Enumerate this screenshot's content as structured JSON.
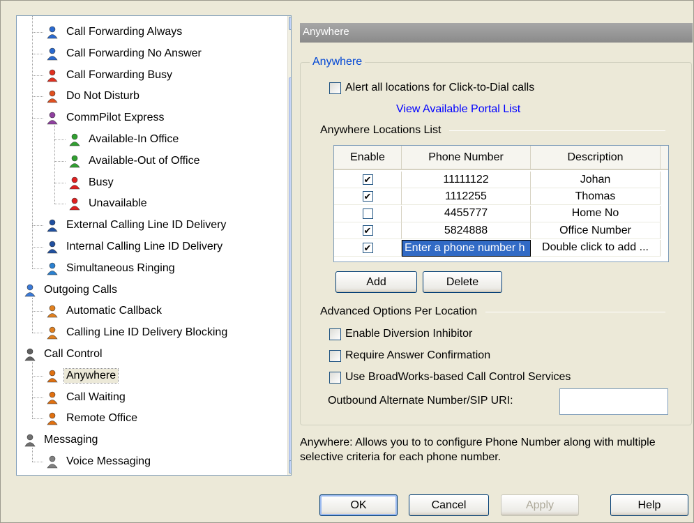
{
  "tree": {
    "items": [
      {
        "label": "Call Forwarding Always",
        "icon": "call-forwarding-always-icon",
        "indent": 2,
        "color": "#2a6ad0"
      },
      {
        "label": "Call Forwarding No Answer",
        "icon": "call-forwarding-no-answer-icon",
        "indent": 2,
        "color": "#2a6ad0"
      },
      {
        "label": "Call Forwarding Busy",
        "icon": "call-forwarding-busy-icon",
        "indent": 2,
        "color": "#e03020"
      },
      {
        "label": "Do Not Disturb",
        "icon": "do-not-disturb-icon",
        "indent": 2,
        "color": "#e05020"
      },
      {
        "label": "CommPilot Express",
        "icon": "commpilot-express-icon",
        "indent": 2,
        "color": "#9040a0"
      },
      {
        "label": "Available-In Office",
        "icon": "available-in-office-icon",
        "indent": 3,
        "color": "#30a030"
      },
      {
        "label": "Available-Out of Office",
        "icon": "available-out-of-office-icon",
        "indent": 3,
        "color": "#30a030"
      },
      {
        "label": "Busy",
        "icon": "busy-icon",
        "indent": 3,
        "color": "#e02020"
      },
      {
        "label": "Unavailable",
        "icon": "unavailable-icon",
        "indent": 3,
        "color": "#e02020"
      },
      {
        "label": "External Calling Line ID Delivery",
        "icon": "external-calling-line-id-icon",
        "indent": 2,
        "color": "#2050a0"
      },
      {
        "label": "Internal Calling Line ID Delivery",
        "icon": "internal-calling-line-id-icon",
        "indent": 2,
        "color": "#2050a0"
      },
      {
        "label": "Simultaneous Ringing",
        "icon": "simultaneous-ringing-icon",
        "indent": 2,
        "color": "#2a80d0"
      },
      {
        "label": "Outgoing Calls",
        "icon": "outgoing-calls-icon",
        "indent": 1,
        "color": "#3a7ad8"
      },
      {
        "label": "Automatic Callback",
        "icon": "automatic-callback-icon",
        "indent": 2,
        "color": "#e08020"
      },
      {
        "label": "Calling Line ID Delivery Blocking",
        "icon": "calling-line-id-blocking-icon",
        "indent": 2,
        "color": "#e08020"
      },
      {
        "label": "Call Control",
        "icon": "call-control-icon",
        "indent": 1,
        "color": "#606060"
      },
      {
        "label": "Anywhere",
        "icon": "anywhere-icon",
        "indent": 2,
        "color": "#e07010",
        "selected": true
      },
      {
        "label": "Call Waiting",
        "icon": "call-waiting-icon",
        "indent": 2,
        "color": "#e07010"
      },
      {
        "label": "Remote Office",
        "icon": "remote-office-icon",
        "indent": 2,
        "color": "#e07010"
      },
      {
        "label": "Messaging",
        "icon": "messaging-icon",
        "indent": 1,
        "color": "#707070"
      },
      {
        "label": "Voice Messaging",
        "icon": "voice-messaging-icon",
        "indent": 2,
        "color": "#808080"
      }
    ]
  },
  "header": {
    "title": "Anywhere"
  },
  "group": {
    "title": "Anywhere"
  },
  "alert_checkbox": {
    "label": "Alert all locations for Click-to-Dial calls",
    "checked": false
  },
  "portal_link": "View Available Portal List",
  "locations": {
    "title": "Anywhere Locations List",
    "columns": [
      "Enable",
      "Phone Number",
      "Description"
    ],
    "rows": [
      {
        "enabled": true,
        "phone": "11111122",
        "description": "Johan"
      },
      {
        "enabled": true,
        "phone": "1112255",
        "description": "Thomas"
      },
      {
        "enabled": false,
        "phone": "4455777",
        "description": "Home No"
      },
      {
        "enabled": true,
        "phone": "5824888",
        "description": "Office Number"
      },
      {
        "enabled": true,
        "phone": "Enter a phone number h",
        "description": "Double click to add ...",
        "editing": true
      }
    ]
  },
  "buttons": {
    "add": "Add",
    "delete": "Delete",
    "ok": "OK",
    "cancel": "Cancel",
    "apply": "Apply",
    "help": "Help"
  },
  "advanced": {
    "title": "Advanced Options Per Location",
    "options": [
      {
        "label": "Enable Diversion Inhibitor",
        "checked": false
      },
      {
        "label": "Require Answer Confirmation",
        "checked": false
      },
      {
        "label": "Use BroadWorks-based Call Control Services",
        "checked": false
      }
    ],
    "outbound_label": "Outbound Alternate Number/SIP URI:",
    "outbound_value": ""
  },
  "description": "Anywhere: Allows you to to configure Phone Number along with multiple selective criteria for each phone number."
}
